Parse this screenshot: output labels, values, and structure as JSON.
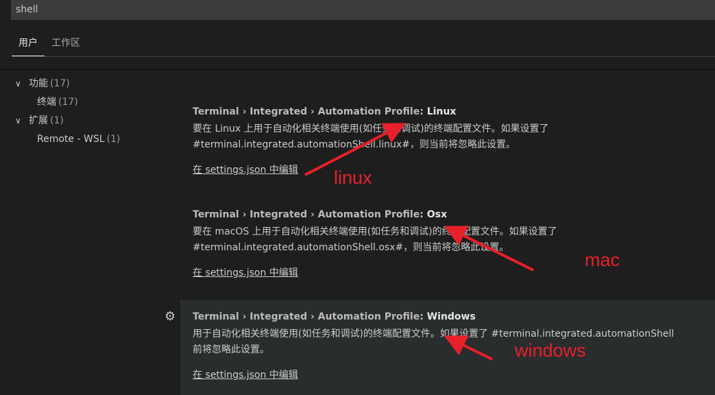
{
  "search": {
    "value": "shell"
  },
  "tabs": [
    {
      "label": "用户"
    },
    {
      "label": "工作区"
    }
  ],
  "tree": [
    {
      "label": "功能",
      "count": "(17)"
    },
    {
      "label": "终端",
      "count": "(17)"
    },
    {
      "label": "扩展",
      "count": "(1)"
    },
    {
      "label": "Remote - WSL",
      "count": "(1)"
    }
  ],
  "settings": [
    {
      "prefix": "Terminal › Integrated › Automation Profile: ",
      "name": "Linux",
      "description": "要在 Linux 上用于自动化相关终端使用(如任务和调试)的终端配置文件。如果设置了\n#terminal.integrated.automationShell.linux#，则当前将忽略此设置。",
      "link": "在 settings.json 中编辑"
    },
    {
      "prefix": "Terminal › Integrated › Automation Profile: ",
      "name": "Osx",
      "description": "要在 macOS 上用于自动化相关终端使用(如任务和调试)的终端配置文件。如果设置了\n#terminal.integrated.automationShell.osx#，则当前将忽略此设置。",
      "link": "在 settings.json 中编辑"
    },
    {
      "prefix": "Terminal › Integrated › Automation Profile: ",
      "name": "Windows",
      "description": "用于自动化相关终端使用(如任务和调试)的终端配置文件。如果设置了 #terminal.integrated.automationShell\n前将忽略此设置。",
      "link": "在 settings.json 中编辑"
    }
  ],
  "annotations": {
    "linux": "linux",
    "mac": "mac",
    "windows": "windows",
    "color": "#e8202a"
  }
}
